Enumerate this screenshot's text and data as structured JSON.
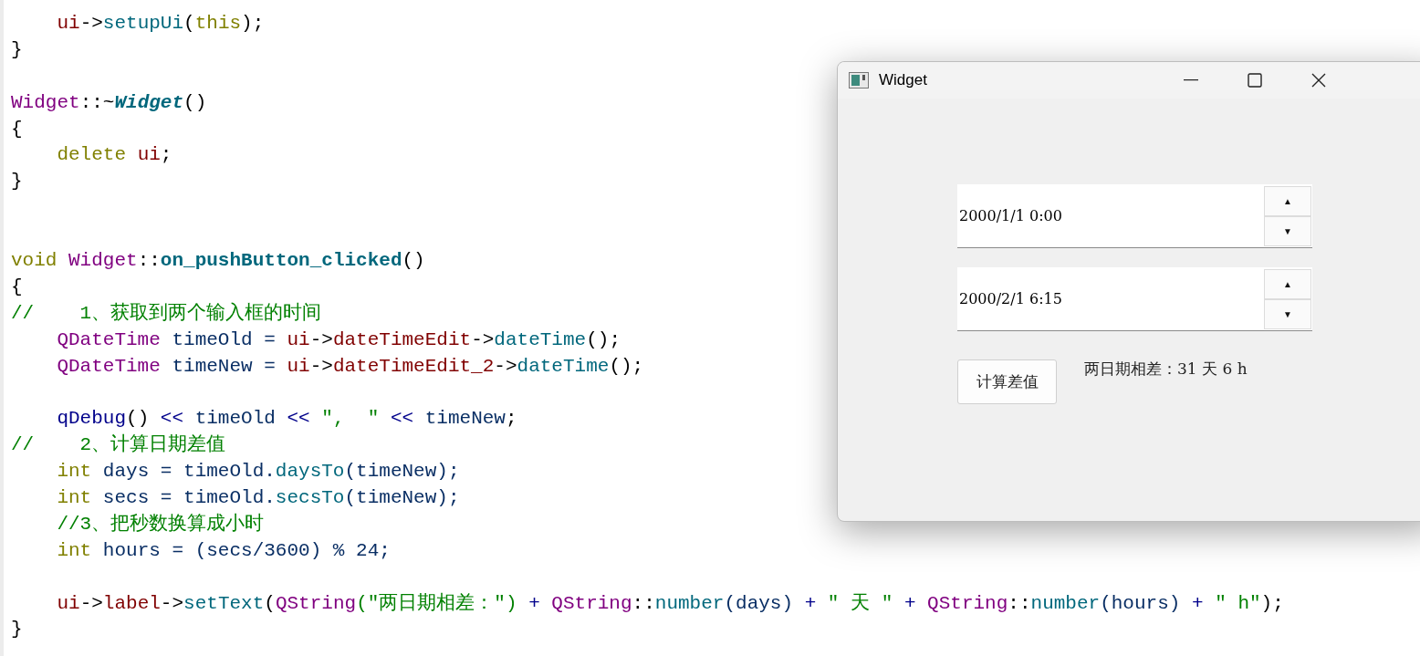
{
  "code_lines": [
    {
      "kind": "code",
      "tokens": [
        {
          "text": "    ui",
          "kind": "member"
        },
        {
          "text": "->",
          "kind": "plain"
        },
        {
          "text": "setupUi",
          "kind": "func"
        },
        {
          "text": "(",
          "kind": "plain"
        },
        {
          "text": "this",
          "kind": "keyword"
        },
        {
          "text": ");",
          "kind": "plain"
        }
      ]
    },
    {
      "kind": "code",
      "tokens": [
        {
          "text": "}",
          "kind": "plain"
        }
      ]
    },
    {
      "kind": "blank"
    },
    {
      "kind": "code",
      "tokens": [
        {
          "text": "Widget",
          "kind": "type"
        },
        {
          "text": "::~",
          "kind": "plain"
        },
        {
          "text": "Widget",
          "kind": "decl"
        },
        {
          "text": "()",
          "kind": "plain"
        }
      ]
    },
    {
      "kind": "code",
      "tokens": [
        {
          "text": "{",
          "kind": "plain"
        }
      ]
    },
    {
      "kind": "code",
      "tokens": [
        {
          "text": "    delete ",
          "kind": "keyword"
        },
        {
          "text": "ui",
          "kind": "member"
        },
        {
          "text": ";",
          "kind": "plain"
        }
      ]
    },
    {
      "kind": "code",
      "tokens": [
        {
          "text": "}",
          "kind": "plain"
        }
      ]
    },
    {
      "kind": "blank"
    },
    {
      "kind": "blank"
    },
    {
      "kind": "code",
      "tokens": [
        {
          "text": "void ",
          "kind": "keyword"
        },
        {
          "text": "Widget",
          "kind": "type"
        },
        {
          "text": "::",
          "kind": "plain"
        },
        {
          "text": "on_pushButton_clicked",
          "kind": "funcbold"
        },
        {
          "text": "()",
          "kind": "plain"
        }
      ]
    },
    {
      "kind": "code",
      "tokens": [
        {
          "text": "{",
          "kind": "plain"
        }
      ]
    },
    {
      "kind": "code",
      "tokens": [
        {
          "text": "//    1、获取到两个输入框的时间",
          "kind": "comment"
        }
      ]
    },
    {
      "kind": "code",
      "tokens": [
        {
          "text": "    QDateTime",
          "kind": "type"
        },
        {
          "text": " timeOld = ",
          "kind": "local"
        },
        {
          "text": "ui",
          "kind": "member"
        },
        {
          "text": "->",
          "kind": "plain"
        },
        {
          "text": "dateTimeEdit",
          "kind": "member"
        },
        {
          "text": "->",
          "kind": "plain"
        },
        {
          "text": "dateTime",
          "kind": "func"
        },
        {
          "text": "();",
          "kind": "plain"
        }
      ]
    },
    {
      "kind": "code",
      "tokens": [
        {
          "text": "    QDateTime",
          "kind": "type"
        },
        {
          "text": " timeNew = ",
          "kind": "local"
        },
        {
          "text": "ui",
          "kind": "member"
        },
        {
          "text": "->",
          "kind": "plain"
        },
        {
          "text": "dateTimeEdit_2",
          "kind": "member"
        },
        {
          "text": "->",
          "kind": "plain"
        },
        {
          "text": "dateTime",
          "kind": "func"
        },
        {
          "text": "();",
          "kind": "plain"
        }
      ]
    },
    {
      "kind": "blank"
    },
    {
      "kind": "code",
      "tokens": [
        {
          "text": "    qDebug",
          "kind": "call"
        },
        {
          "text": "() ",
          "kind": "plain"
        },
        {
          "text": "<<",
          "kind": "operator"
        },
        {
          "text": " timeOld ",
          "kind": "local"
        },
        {
          "text": "<<",
          "kind": "operator"
        },
        {
          "text": " \",  \" ",
          "kind": "string"
        },
        {
          "text": "<<",
          "kind": "operator"
        },
        {
          "text": " timeNew",
          "kind": "local"
        },
        {
          "text": ";",
          "kind": "plain"
        }
      ]
    },
    {
      "kind": "code",
      "tokens": [
        {
          "text": "//    2、计算日期差值",
          "kind": "comment"
        }
      ]
    },
    {
      "kind": "code",
      "tokens": [
        {
          "text": "    int",
          "kind": "keyword"
        },
        {
          "text": " days = timeOld.",
          "kind": "local"
        },
        {
          "text": "daysTo",
          "kind": "func"
        },
        {
          "text": "(timeNew);",
          "kind": "local"
        }
      ]
    },
    {
      "kind": "code",
      "tokens": [
        {
          "text": "    int",
          "kind": "keyword"
        },
        {
          "text": " secs = timeOld.",
          "kind": "local"
        },
        {
          "text": "secsTo",
          "kind": "func"
        },
        {
          "text": "(timeNew);",
          "kind": "local"
        }
      ]
    },
    {
      "kind": "code",
      "tokens": [
        {
          "text": "    //3、把秒数换算成小时",
          "kind": "comment"
        }
      ]
    },
    {
      "kind": "code",
      "tokens": [
        {
          "text": "    int",
          "kind": "keyword"
        },
        {
          "text": " hours = (secs/3600) % 24;",
          "kind": "local"
        }
      ]
    },
    {
      "kind": "blank"
    },
    {
      "kind": "code",
      "tokens": [
        {
          "text": "    ui",
          "kind": "member"
        },
        {
          "text": "->",
          "kind": "plain"
        },
        {
          "text": "label",
          "kind": "member"
        },
        {
          "text": "->",
          "kind": "plain"
        },
        {
          "text": "setText",
          "kind": "func"
        },
        {
          "text": "(",
          "kind": "plain"
        },
        {
          "text": "QString",
          "kind": "type"
        },
        {
          "text": "(\"两日期相差：\") ",
          "kind": "string"
        },
        {
          "text": "+ ",
          "kind": "operator"
        },
        {
          "text": "QString",
          "kind": "type"
        },
        {
          "text": "::",
          "kind": "plain"
        },
        {
          "text": "number",
          "kind": "func"
        },
        {
          "text": "(days) ",
          "kind": "local"
        },
        {
          "text": "+",
          "kind": "operator"
        },
        {
          "text": " \" 天 \" ",
          "kind": "string"
        },
        {
          "text": "+ ",
          "kind": "operator"
        },
        {
          "text": "QString",
          "kind": "type"
        },
        {
          "text": "::",
          "kind": "plain"
        },
        {
          "text": "number",
          "kind": "func"
        },
        {
          "text": "(hours) ",
          "kind": "local"
        },
        {
          "text": "+",
          "kind": "operator"
        },
        {
          "text": " \" h\"",
          "kind": "string"
        },
        {
          "text": ");",
          "kind": "plain"
        }
      ]
    },
    {
      "kind": "code",
      "tokens": [
        {
          "text": "}",
          "kind": "plain"
        }
      ]
    }
  ],
  "window": {
    "title": "Widget",
    "date_edits": [
      {
        "value": "2000/1/1 0:00",
        "up": "▲",
        "down": "▼"
      },
      {
        "value": "2000/2/1 6:15",
        "up": "▲",
        "down": "▼"
      }
    ],
    "button": "计算差值",
    "result_label": "两日期相差：31 天 6 h"
  }
}
